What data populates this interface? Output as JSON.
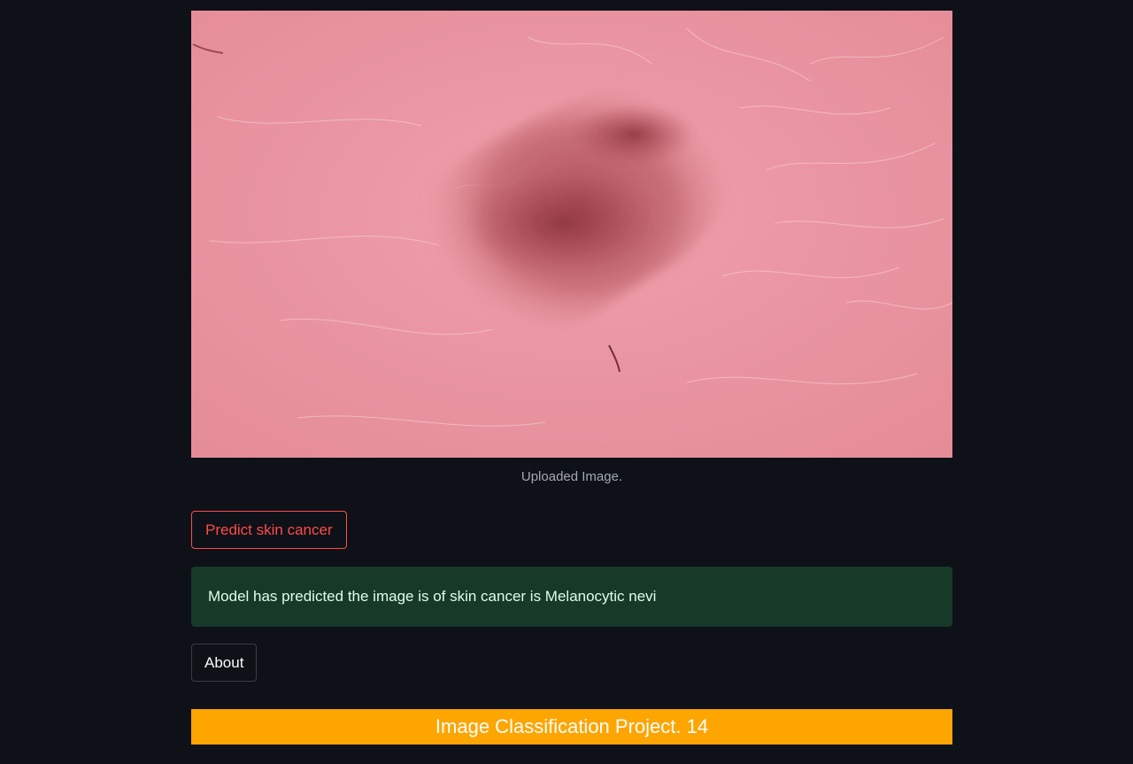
{
  "image": {
    "caption": "Uploaded Image.",
    "subject": "dermoscopic-skin-lesion"
  },
  "actions": {
    "predict_label": "Predict skin cancer",
    "about_label": "About"
  },
  "result": {
    "message": "Model has predicted the image is of skin cancer is Melanocytic nevi"
  },
  "footer": {
    "title": "Image Classification Project. 14"
  },
  "colors": {
    "background": "#0e1117",
    "accent_red": "#ff4b4b",
    "success_bg": "#173928",
    "success_text": "#dffde9",
    "footer_bg": "#ffa500"
  }
}
